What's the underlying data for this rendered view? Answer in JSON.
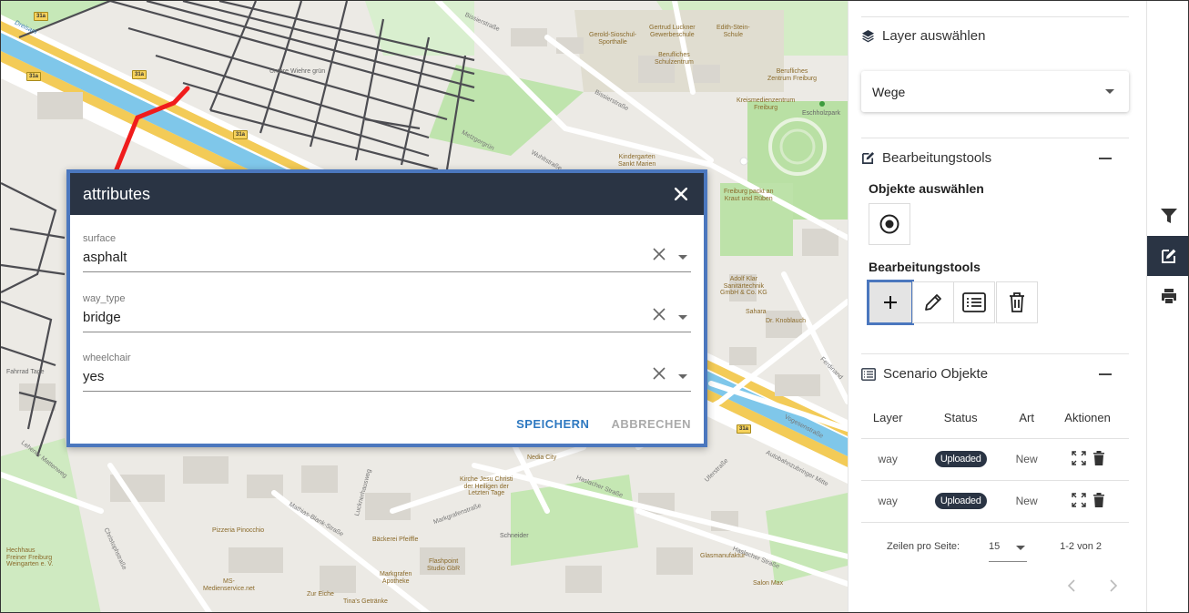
{
  "map": {
    "labels": {
      "dreisam": "Dreisam",
      "unterwiehre": "Untere Wiehre grün",
      "bissierer": "Bissierstraße",
      "bissierer2": "Bissierstraße",
      "gerold": "Gerold-Sioschul-\nSporthalle",
      "gertrud": "Gertrud Luckner\nGewerbeschule",
      "edith": "Edith-Stein-\nSchule",
      "berufliches": "Berufliches\nSchulzentrum",
      "zentrum": "Berufliches\nZentrum Freiburg",
      "kreis": "Kreismedienzentrum\nFreiburg",
      "eschholz": "Eschholzpark",
      "kinder": "Kindergarten\nSankt Marien",
      "fgkraut": "Freiburg packt an\nKraut und Rüben",
      "adolf": "Adolf Klar\nSanitärtechnik\nGmbH & Co. KG",
      "sahara": "Sahara",
      "knoblauch": "Dr. Knoblauch",
      "ferdinand": "Ferdinand",
      "vogesen": "Vogesenstraße",
      "autobahn": "Autobahnzubringer Mitte",
      "ufer": "Uferstraße",
      "haslacher": "Haslacher Straße",
      "haslacher2": "Haslacher Straße",
      "glas": "Glasmanufaktur",
      "salon": "Salon Max",
      "kirche": "Kirche Jesu Christi\nder Heiligen der\nLetzten Tage",
      "nedia": "Nedia City",
      "schneider": "Schneider",
      "flashpoint": "Flashpoint\nStudio GbR",
      "markgrafen": "Markgrafenstraße",
      "markgrafen_apo": "Markgrafen\nApotheke",
      "baecker": "Bäckerei Pfeiffle",
      "mathias": "Mathias-Blank-Straße",
      "luckner": "Lucknerhausweg",
      "pizzeria": "Pizzeria Pinocchio",
      "christoph": "Christophstraße",
      "ms": "MS-\nMedienservice.net",
      "zur_eiche": "Zur Eiche",
      "tinas": "Tina's Getränke",
      "hechhaus": "Hechhaus\nFreiner Freiburg\nWeingarten e. V.",
      "lehener": "Lehener Mattenweg",
      "mezgerg": "Metzgergrün",
      "wuhlt": "Wuhltstraße",
      "fahrrad": "Fahrrad Tage"
    },
    "shields": [
      "31a",
      "31a",
      "31a",
      "31a",
      "31a"
    ],
    "colors": {
      "motorway": "#f3cb57",
      "river": "#7fc7ea",
      "park": "#b7e3a3",
      "edited_line": "#f01c1c",
      "ways": "#4d4d52"
    }
  },
  "dialog": {
    "title": "attributes",
    "close_icon": "close-icon",
    "fields": [
      {
        "label": "surface",
        "value": "asphalt"
      },
      {
        "label": "way_type",
        "value": "bridge"
      },
      {
        "label": "wheelchair",
        "value": "yes"
      }
    ],
    "save_label": "SPEICHERN",
    "cancel_label": "ABBRECHEN"
  },
  "sidebar": {
    "layer_heading": "Layer auswählen",
    "layer_value": "Wege",
    "tools_heading": "Bearbeitungstools",
    "select_objects_label": "Objekte auswählen",
    "tools_sub_label": "Bearbeitungstools",
    "scenario_heading": "Scenario Objekte",
    "table": {
      "headers": [
        "Layer",
        "Status",
        "Art",
        "Aktionen"
      ],
      "rows": [
        {
          "layer": "way",
          "status": "Uploaded",
          "art": "New"
        },
        {
          "layer": "way",
          "status": "Uploaded",
          "art": "New"
        }
      ]
    },
    "pager": {
      "rows_label": "Zeilen pro Seite:",
      "rows_value": "15",
      "range": "1-2 von 2"
    },
    "accent": "#2a3444"
  },
  "rail": {
    "items": [
      "filter-icon",
      "edit-icon",
      "print-icon"
    ],
    "active": "edit-icon"
  }
}
